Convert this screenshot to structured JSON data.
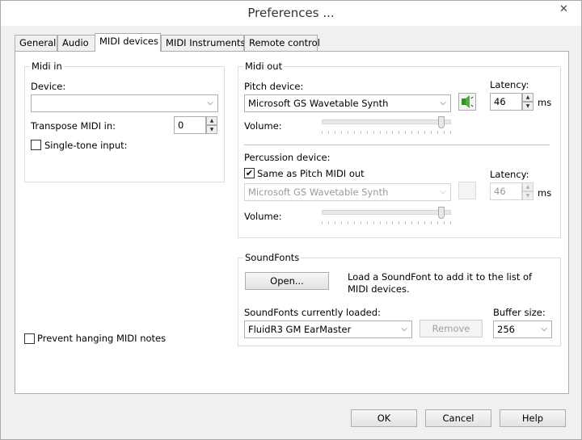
{
  "window": {
    "title": "Preferences ...",
    "close_glyph": "✕"
  },
  "tabs": [
    {
      "label": "General"
    },
    {
      "label": "Audio"
    },
    {
      "label": "MIDI devices"
    },
    {
      "label": "MIDI Instruments"
    },
    {
      "label": "Remote control"
    }
  ],
  "active_tab": "MIDI devices",
  "midi_in": {
    "title": "Midi in",
    "device_label": "Device:",
    "device_value": "",
    "transpose_label": "Transpose MIDI in:",
    "transpose_value": "0",
    "single_tone_label": "Single-tone input:",
    "single_tone_checked": false
  },
  "prevent_hanging": {
    "label": "Prevent hanging MIDI notes",
    "checked": false
  },
  "midi_out": {
    "title": "Midi out",
    "pitch_device_label": "Pitch device:",
    "pitch_device_value": "Microsoft GS Wavetable Synth",
    "latency_label": "Latency:",
    "latency_value": "46",
    "latency_unit": "ms",
    "volume_label": "Volume:",
    "pitch_volume_level": 0.95,
    "percussion_device_label": "Percussion device:",
    "same_as_pitch_label": "Same as Pitch MIDI out",
    "same_as_pitch_checked": true,
    "check_glyph": "✔",
    "percussion_device_value": "Microsoft GS Wavetable Synth",
    "perc_latency_label": "Latency:",
    "perc_latency_value": "46",
    "perc_latency_unit": "ms",
    "perc_volume_label": "Volume:",
    "perc_volume_level": 0.95,
    "speaker_icon": "speaker-icon"
  },
  "soundfonts": {
    "title": "SoundFonts",
    "open_label": "Open...",
    "description": "Load a SoundFont to add it to the list of MIDI devices.",
    "loaded_label": "SoundFonts currently loaded:",
    "loaded_value": "FluidR3 GM EarMaster",
    "remove_label": "Remove",
    "buffer_label": "Buffer size:",
    "buffer_value": "256"
  },
  "footer": {
    "ok_label": "OK",
    "cancel_label": "Cancel",
    "help_label": "Help"
  },
  "glyphs": {
    "dropdown": "⌵",
    "spin_up": "▲",
    "spin_down": "▼"
  }
}
